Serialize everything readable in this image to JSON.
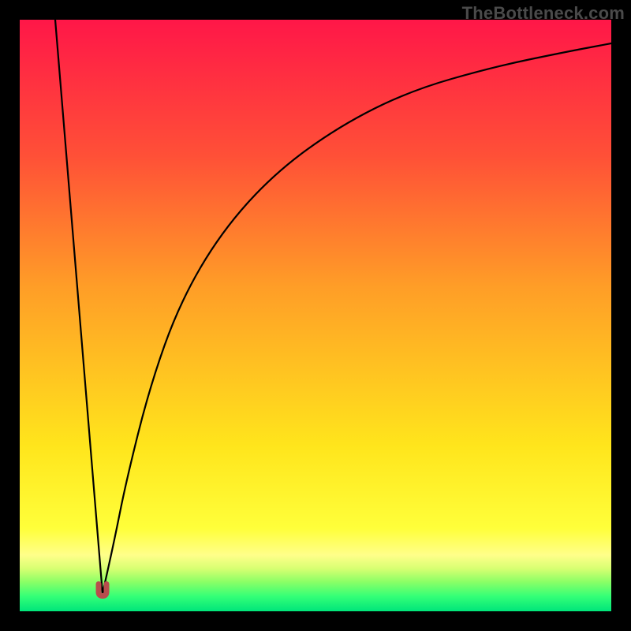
{
  "watermark": "TheBottleneck.com",
  "chart_data": {
    "type": "line",
    "title": "",
    "xlabel": "",
    "ylabel": "",
    "xlim": [
      0,
      100
    ],
    "ylim": [
      0,
      100
    ],
    "grid": false,
    "legend": false,
    "background": {
      "style": "vertical-gradient",
      "description": "Red at top through orange and yellow to bright green at bottom",
      "stops": [
        {
          "pos": 0.0,
          "color": "#ff1748"
        },
        {
          "pos": 0.23,
          "color": "#ff5037"
        },
        {
          "pos": 0.45,
          "color": "#ff9d27"
        },
        {
          "pos": 0.72,
          "color": "#ffe51c"
        },
        {
          "pos": 0.86,
          "color": "#ffff3a"
        },
        {
          "pos": 0.905,
          "color": "#ffff8a"
        },
        {
          "pos": 0.928,
          "color": "#d7ff72"
        },
        {
          "pos": 0.95,
          "color": "#8cff66"
        },
        {
          "pos": 0.975,
          "color": "#33ff77"
        },
        {
          "pos": 1.0,
          "color": "#00e57a"
        }
      ]
    },
    "series": [
      {
        "name": "bottleneck-curve",
        "description": "V-shaped curve: steep linear descent from top-left to a cusp near x≈14, then rising concave curve toward top-right.",
        "min_x": 14,
        "min_y": 3,
        "left_branch": {
          "x": [
            6,
            14
          ],
          "y": [
            100,
            3
          ]
        },
        "right_branch_samples": {
          "x": [
            14,
            16,
            18,
            22,
            27,
            34,
            43,
            54,
            66,
            80,
            92,
            100
          ],
          "y": [
            3,
            12,
            22,
            38,
            52,
            64,
            74,
            82,
            88,
            92,
            94.5,
            96
          ]
        }
      }
    ],
    "marker": {
      "description": "Small dark-red U-shaped marker at curve minimum",
      "x": 14,
      "y": 3,
      "color": "#b84d4d"
    }
  }
}
